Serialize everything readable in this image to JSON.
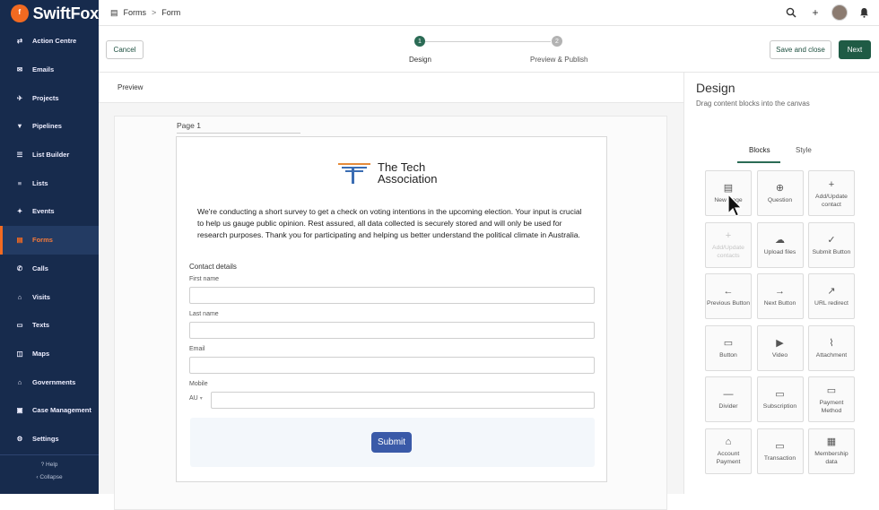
{
  "app": {
    "brand": "SwiftFox",
    "brand_color": "#f26a21",
    "sidebar_bg": "#172b4d"
  },
  "sidebar": {
    "items": [
      {
        "label": "Action Centre",
        "icon": "action-centre-icon",
        "glyph": "⇄",
        "active": false
      },
      {
        "label": "Emails",
        "icon": "email-icon",
        "glyph": "✉",
        "active": false
      },
      {
        "label": "Projects",
        "icon": "rocket-icon",
        "glyph": "✈",
        "active": false
      },
      {
        "label": "Pipelines",
        "icon": "filter-icon",
        "glyph": "▼",
        "active": false
      },
      {
        "label": "List Builder",
        "icon": "list-builder-icon",
        "glyph": "☰",
        "active": false
      },
      {
        "label": "Lists",
        "icon": "list-icon",
        "glyph": "≡",
        "active": false
      },
      {
        "label": "Events",
        "icon": "events-icon",
        "glyph": "✦",
        "active": false
      },
      {
        "label": "Forms",
        "icon": "forms-icon",
        "glyph": "▤",
        "active": true
      },
      {
        "label": "Calls",
        "icon": "phone-icon",
        "glyph": "✆",
        "active": false
      },
      {
        "label": "Visits",
        "icon": "visits-icon",
        "glyph": "⌂",
        "active": false
      },
      {
        "label": "Texts",
        "icon": "chat-icon",
        "glyph": "▭",
        "active": false
      },
      {
        "label": "Maps",
        "icon": "map-icon",
        "glyph": "◫",
        "active": false
      },
      {
        "label": "Governments",
        "icon": "government-icon",
        "glyph": "⌂",
        "active": false
      },
      {
        "label": "Case Management",
        "icon": "briefcase-icon",
        "glyph": "▣",
        "active": false
      },
      {
        "label": "Settings",
        "icon": "gear-icon",
        "glyph": "⚙",
        "active": false
      }
    ],
    "help": "? Help",
    "collapse": "‹ Collapse"
  },
  "topbar": {
    "crumbs": [
      "Forms",
      "Form"
    ],
    "separator": ">"
  },
  "actions": {
    "cancel": "Cancel",
    "save_close": "Save and close",
    "next": "Next",
    "steps": [
      {
        "num": "1",
        "label": "Design",
        "done": true
      },
      {
        "num": "2",
        "label": "Preview & Publish",
        "done": false
      }
    ]
  },
  "canvas": {
    "preview_tab": "Preview",
    "page_label": "Page 1",
    "org_line1": "The Tech",
    "org_line2": "Association",
    "intro": "We're conducting a short survey to get a check on voting intentions in the upcoming election. Your input is crucial to help us gauge public opinion. Rest assured, all data collected is securely stored and will only be used for research purposes. Thank you for participating and helping us better understand the political climate in Australia.",
    "section": "Contact details",
    "fields": {
      "first_name": "First name",
      "last_name": "Last name",
      "email": "Email",
      "mobile": "Mobile"
    },
    "country_code": "AU",
    "submit": "Submit"
  },
  "design": {
    "title": "Design",
    "subtitle": "Drag content blocks into the canvas",
    "tabs": [
      "Blocks",
      "Style"
    ],
    "blocks": [
      {
        "label": "New Page",
        "icon": "new-page-icon",
        "glyph": "▤",
        "disabled": false
      },
      {
        "label": "Question",
        "icon": "add-circle-icon",
        "glyph": "⊕",
        "disabled": false
      },
      {
        "label": "Add/Update contact",
        "icon": "add-person-icon",
        "glyph": "+",
        "disabled": false
      },
      {
        "label": "Add/Update contacts",
        "icon": "add-people-icon",
        "glyph": "+",
        "disabled": true
      },
      {
        "label": "Upload files",
        "icon": "cloud-upload-icon",
        "glyph": "☁",
        "disabled": false
      },
      {
        "label": "Submit Button",
        "icon": "check-circle-icon",
        "glyph": "✓",
        "disabled": false
      },
      {
        "label": "Previous Button",
        "icon": "arrow-left-icon",
        "glyph": "←",
        "disabled": false
      },
      {
        "label": "Next Button",
        "icon": "arrow-right-icon",
        "glyph": "→",
        "disabled": false
      },
      {
        "label": "URL redirect",
        "icon": "external-link-icon",
        "glyph": "↗",
        "disabled": false
      },
      {
        "label": "Button",
        "icon": "button-icon",
        "glyph": "▭",
        "disabled": false
      },
      {
        "label": "Video",
        "icon": "video-icon",
        "glyph": "▶",
        "disabled": false
      },
      {
        "label": "Attachment",
        "icon": "paperclip-icon",
        "glyph": "⌇",
        "disabled": false
      },
      {
        "label": "Divider",
        "icon": "divider-icon",
        "glyph": "—",
        "disabled": false
      },
      {
        "label": "Subscription",
        "icon": "subscription-icon",
        "glyph": "▭",
        "disabled": false
      },
      {
        "label": "Payment Method",
        "icon": "credit-card-icon",
        "glyph": "▭",
        "disabled": false
      },
      {
        "label": "Account Payment",
        "icon": "bank-icon",
        "glyph": "⌂",
        "disabled": false
      },
      {
        "label": "Transaction",
        "icon": "transaction-icon",
        "glyph": "▭",
        "disabled": false
      },
      {
        "label": "Membership data",
        "icon": "membership-icon",
        "glyph": "▦",
        "disabled": false
      }
    ]
  }
}
